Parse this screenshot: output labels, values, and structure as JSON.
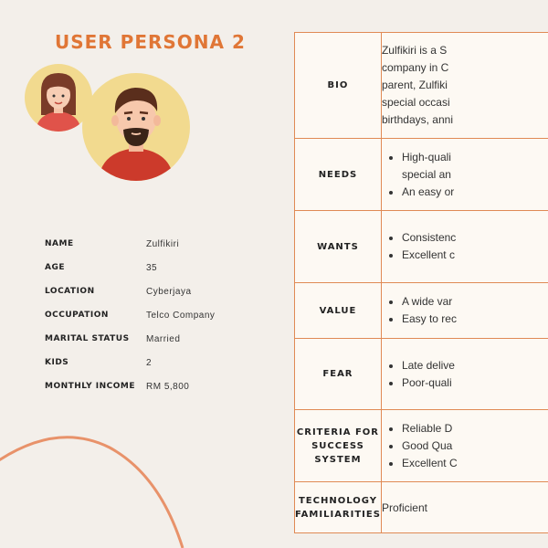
{
  "title": "USER PERSONA 2",
  "profile": [
    {
      "label": "NAME",
      "value": "Zulfikiri"
    },
    {
      "label": "AGE",
      "value": "35"
    },
    {
      "label": "LOCATION",
      "value": "Cyberjaya"
    },
    {
      "label": "OCCUPATION",
      "value": "Telco Company"
    },
    {
      "label": "MARITAL STATUS",
      "value": "Married"
    },
    {
      "label": "KIDS",
      "value": "2"
    },
    {
      "label": "MONTHLY INCOME",
      "value": "RM 5,800"
    }
  ],
  "table": {
    "bio": {
      "label": "BIO",
      "lines": [
        "Zulfikiri is a S",
        "company in C",
        "parent, Zulfiki",
        "special occasi",
        "birthdays, anni"
      ]
    },
    "needs": {
      "label": "NEEDS",
      "items": [
        "High-quali",
        "special an",
        "An easy or"
      ]
    },
    "wants": {
      "label": "WANTS",
      "items": [
        "Consistenc",
        "Excellent c"
      ]
    },
    "value": {
      "label": "VALUE",
      "items": [
        "A wide var",
        "Easy to rec"
      ]
    },
    "fear": {
      "label": "FEAR",
      "items": [
        "Late delive",
        "Poor-quali"
      ]
    },
    "criteria": {
      "label_line1": "CRITERIA FOR SUCCESS",
      "label_line2": "SYSTEM",
      "items": [
        "Reliable D",
        "Good Qua",
        "Excellent C"
      ]
    },
    "technology": {
      "label_line1": "TECHNOLOGY",
      "label_line2": "FAMILIARITIES",
      "text": "Proficient"
    }
  },
  "colors": {
    "accent": "#e07636",
    "table_border": "#e08a55",
    "avatar_bg": "#f2da8f",
    "background": "#f3efea"
  }
}
